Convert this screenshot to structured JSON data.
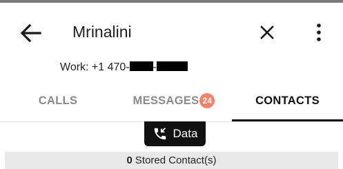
{
  "header": {
    "contact_name": "Mrinalini",
    "phone_label": "Work: +1 470-",
    "phone_separator": "-"
  },
  "tabs": {
    "calls": "CALLS",
    "messages": "MESSAGES",
    "messages_badge": "24",
    "contacts": "CONTACTS",
    "active": "CONTACTS"
  },
  "data_button": {
    "label": "Data"
  },
  "stored": {
    "count": "0",
    "label": "Stored Contact(s)"
  },
  "colors": {
    "badge": "#f1836b",
    "active_tab": "#111111",
    "inactive_tab": "#8a8a8a",
    "stored_bar": "#e8e8e8"
  },
  "icons": [
    "back-arrow-icon",
    "close-icon",
    "more-vert-icon",
    "phone-callback-icon"
  ]
}
